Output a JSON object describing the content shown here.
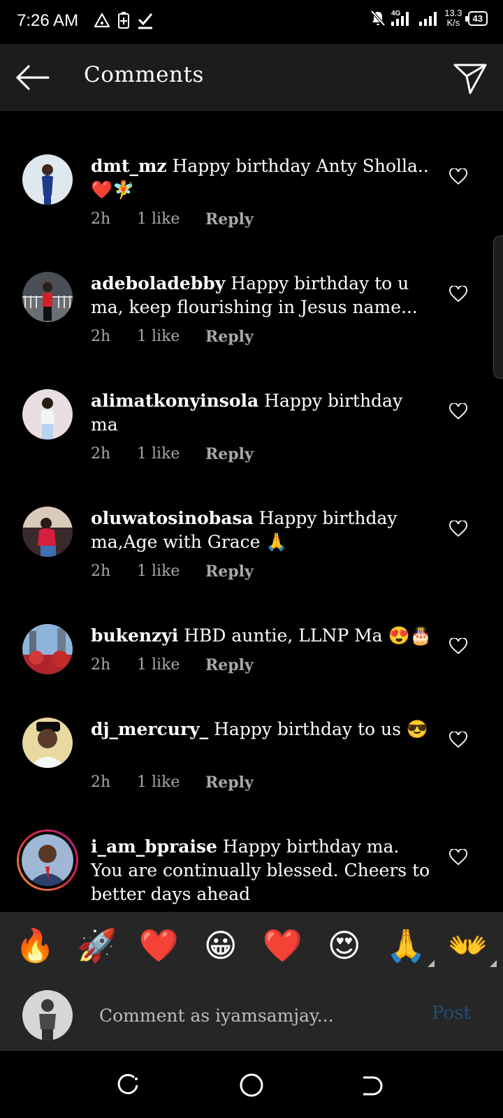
{
  "status_bar": {
    "time": "7:26 AM",
    "net_speed_value": "13.3",
    "net_speed_unit": "K/s",
    "network_type": "4G",
    "battery": "43"
  },
  "header": {
    "title": "Comments"
  },
  "comments": [
    {
      "username": "dmt_mz",
      "text": "Happy birthday Anty Sholla.. ❤️🧚",
      "time": "2h",
      "likes": "1 like",
      "reply": "Reply"
    },
    {
      "username": "adeboladebby",
      "text": "Happy birthday to u ma, keep flourishing in Jesus name...",
      "time": "2h",
      "likes": "1 like",
      "reply": "Reply"
    },
    {
      "username": "alimatkonyinsola",
      "text": "Happy birthday ma",
      "time": "2h",
      "likes": "1 like",
      "reply": "Reply"
    },
    {
      "username": "oluwatosinobasa",
      "text": "Happy birthday ma,Age with Grace 🙏",
      "time": "2h",
      "likes": "1 like",
      "reply": "Reply"
    },
    {
      "username": "bukenzyi",
      "text": "HBD auntie, LLNP Ma 😍🎂",
      "time": "2h",
      "likes": "1 like",
      "reply": "Reply"
    },
    {
      "username": "dj_mercury_",
      "text": "Happy birthday to us 😎",
      "time": "2h",
      "likes": "1 like",
      "reply": "Reply"
    },
    {
      "username": "i_am_bpraise",
      "text": "Happy birthday ma. You are continually blessed. Cheers to better days ahead",
      "time": "",
      "likes": "",
      "reply": ""
    }
  ],
  "emoji_bar": [
    "🔥",
    "🚀",
    "❤️",
    "😀",
    "❤️",
    "😍",
    "🙏",
    "👐"
  ],
  "compose": {
    "placeholder": "Comment as iyamsamjay...",
    "post_label": "Post"
  },
  "colors": {
    "background": "#000000",
    "header_bg": "#1c1c1c",
    "compose_bg": "#262626",
    "meta_text": "#a8a8a8",
    "post_link": "#1f4e79",
    "story_ring_start": "#f09433",
    "story_ring_end": "#bc1888"
  }
}
